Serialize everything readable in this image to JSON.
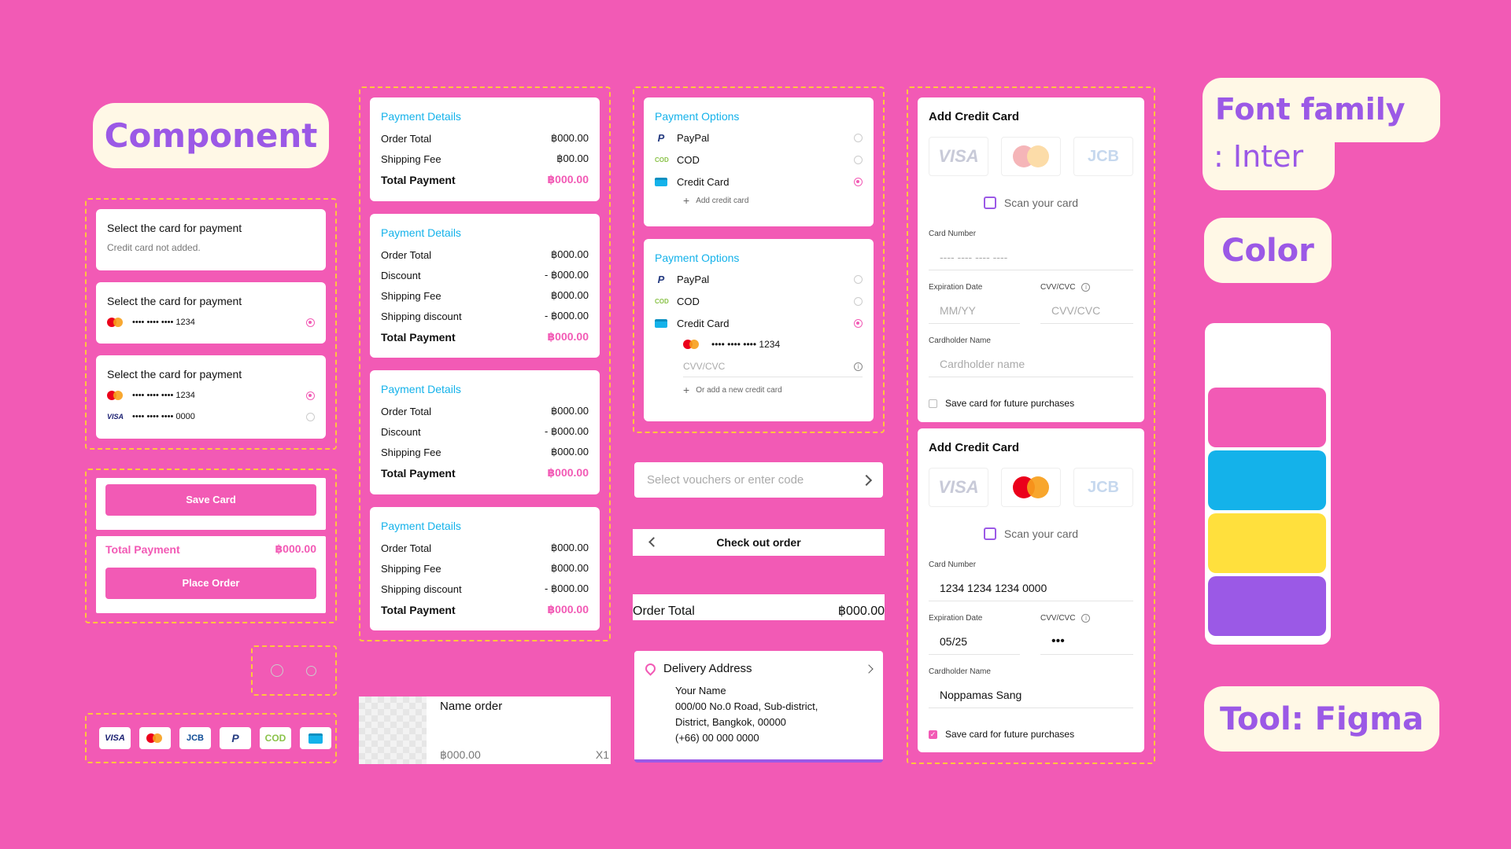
{
  "headings": {
    "component": "Component",
    "font": "Font family",
    "font_name": ": Inter",
    "color": "Color",
    "tool": "Tool: Figma"
  },
  "colors": {
    "background": "#F25AB5",
    "pink": "#F25AB5",
    "blue": "#14B2EA",
    "yellow": "#FFE03D",
    "purple": "#9B59E6",
    "white": "#FFFFFF",
    "cream": "#FFF8E6"
  },
  "palette": [
    "#FFFFFF",
    "#F25AB5",
    "#14B2EA",
    "#FFE03D",
    "#9B59E6"
  ],
  "select_card": {
    "title": "Select the card for payment",
    "not_added": "Credit card not added.",
    "mask_1234": "•••• •••• •••• 1234",
    "mask_0000": "•••• •••• •••• 0000",
    "visa": "VISA"
  },
  "actions": {
    "save_card": "Save Card",
    "total_payment": "Total Payment",
    "total_value": "฿000.00",
    "place_order": "Place Order"
  },
  "payment_logos": {
    "visa": "VISA",
    "jcb": "JCB",
    "paypal": "P",
    "cod": "COD"
  },
  "payment_details": {
    "title": "Payment Details",
    "order_total": "Order Total",
    "shipping_fee": "Shipping Fee",
    "discount": "Discount",
    "shipping_discount": "Shipping discount",
    "total_payment": "Total Payment",
    "value": "฿000.00",
    "shipping_small": "฿00.00",
    "neg_value": "- ฿000.00"
  },
  "name_order": {
    "name": "Name order",
    "price": "฿000.00",
    "qty": "X1"
  },
  "payment_options": {
    "title": "Payment Options",
    "paypal": "PayPal",
    "cod": "COD",
    "cod_badge": "COD",
    "credit_card": "Credit Card",
    "add_credit": "Add credit card",
    "card_mask": "•••• •••• •••• 1234",
    "cvv_placeholder": "CVV/CVC",
    "or_add": "Or add a new credit card"
  },
  "voucher": {
    "placeholder": "Select vouchers or enter code"
  },
  "checkout": {
    "title": "Check out order"
  },
  "order_total_bar": {
    "label": "Order Total",
    "value": "฿000.00"
  },
  "delivery": {
    "title": "Delivery Address",
    "name": "Your Name",
    "line1": "000/00  No.0 Road, Sub-district,",
    "line2": "District, Bangkok, 00000",
    "phone": "(+66) 00 000 0000"
  },
  "add_card": {
    "title": "Add Credit Card",
    "scan": "Scan your card",
    "card_number": "Card Number",
    "card_placeholder": "---- ---- ---- ----",
    "expiry": "Expiration Date",
    "expiry_placeholder": "MM/YY",
    "cvv": "CVV/CVC",
    "cvv_placeholder": "CVV/CVC",
    "holder": "Cardholder Name",
    "holder_placeholder": "Cardholder name",
    "save": "Save card for future purchases",
    "visa": "VISA",
    "jcb": "JCB"
  },
  "add_card_filled": {
    "card_number": "1234 1234 1234 0000",
    "expiry": "05/25",
    "cvv": "•••",
    "holder": "Noppamas Sang"
  }
}
